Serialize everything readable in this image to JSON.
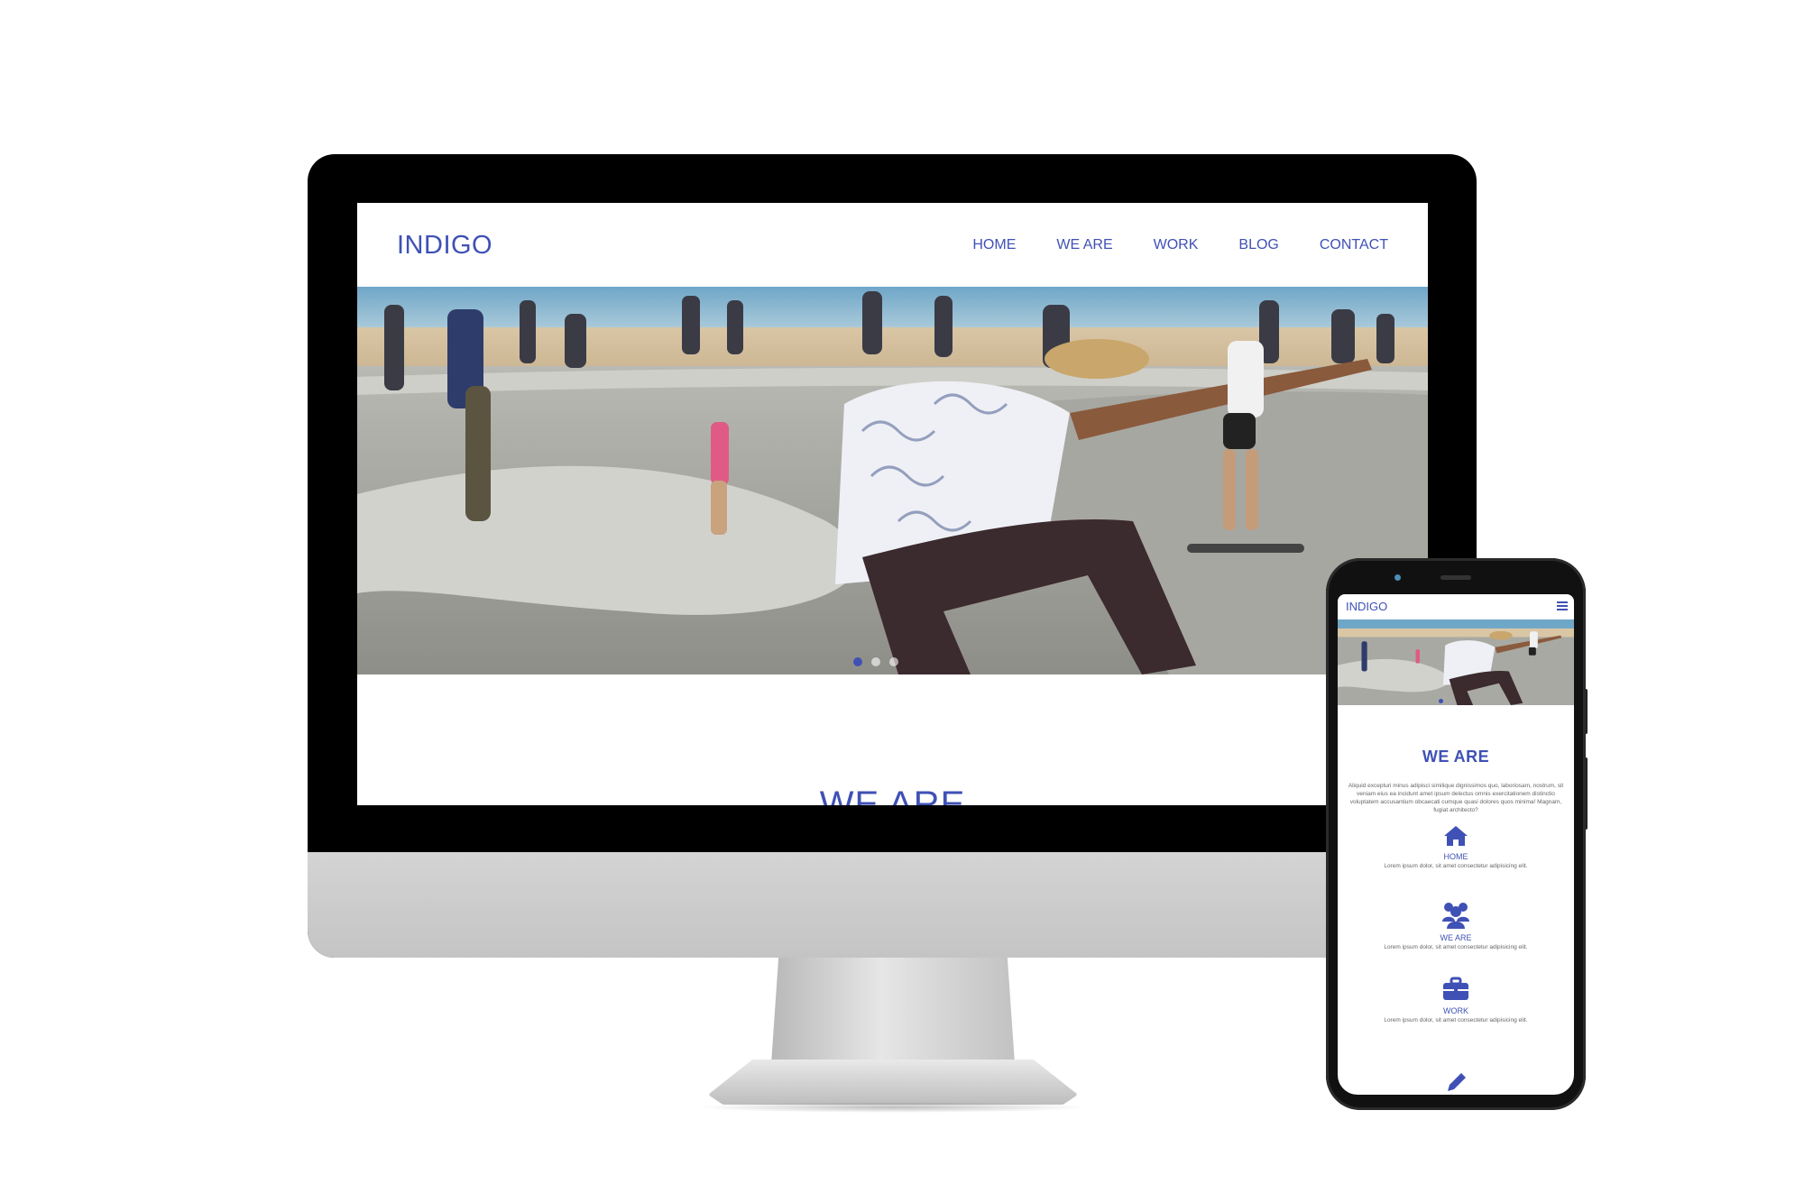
{
  "desktop": {
    "logo": "INDIGO",
    "nav": [
      {
        "label": "HOME"
      },
      {
        "label": "WE ARE"
      },
      {
        "label": "WORK"
      },
      {
        "label": "BLOG"
      },
      {
        "label": "CONTACT"
      }
    ],
    "section_title": "WE ARE"
  },
  "mobile": {
    "logo": "INDIGO",
    "section_title": "WE ARE",
    "paragraph": "Aliquid excepturi minus adipisci similique dignissimos quo, laboriosam, nostrum, sit veniam eius ea incidunt amet ipsum delectus omnis exercitationem distinctio voluptatem accusantium obcaecati cumque quasi dolores quos minima! Magnam, fugiat architecto?",
    "features": [
      {
        "icon": "home-icon",
        "title": "HOME",
        "text": "Lorem ipsum dolor, sit amet consectetur adipisicing elit."
      },
      {
        "icon": "users-icon",
        "title": "WE ARE",
        "text": "Lorem ipsum dolor, sit amet consectetur adipisicing elit."
      },
      {
        "icon": "briefcase-icon",
        "title": "WORK",
        "text": "Lorem ipsum dolor, sit amet consectetur adipisicing elit."
      },
      {
        "icon": "pencil-icon"
      }
    ]
  },
  "colors": {
    "accent": "#3f51b5"
  }
}
